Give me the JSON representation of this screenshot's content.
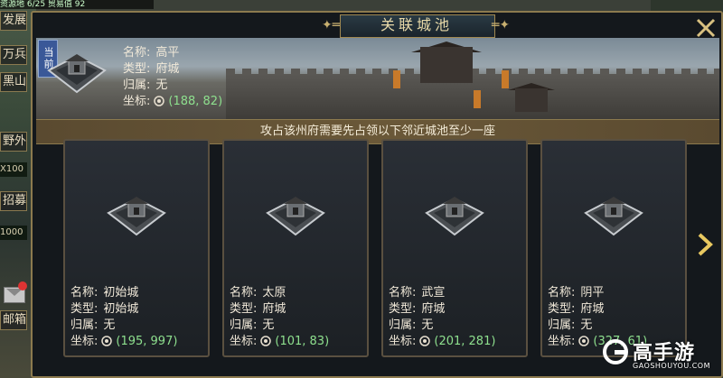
{
  "background": {
    "resource_text": "资源地 6/25  贸易值 92",
    "side_tabs": [
      "发展",
      "万兵",
      "黑山",
      "野外",
      "招募",
      "邮箱"
    ],
    "side_values": [
      "X100",
      "1000"
    ]
  },
  "dialog": {
    "title": "关联城池",
    "current_tag": "当前",
    "labels": {
      "name": "名称:",
      "type": "类型:",
      "owner": "归属:",
      "coord": "坐标:"
    },
    "current_city": {
      "name": "高平",
      "type": "府城",
      "owner": "无",
      "coord": "(188, 82)"
    },
    "notice": "攻占该州府需要先占领以下邻近城池至少一座",
    "cities": [
      {
        "name": "初始城",
        "type": "初始城",
        "owner": "无",
        "coord": "(195, 997)"
      },
      {
        "name": "太原",
        "type": "府城",
        "owner": "无",
        "coord": "(101, 83)"
      },
      {
        "name": "武宣",
        "type": "府城",
        "owner": "无",
        "coord": "(201, 281)"
      },
      {
        "name": "阴平",
        "type": "府城",
        "owner": "无",
        "coord": "(327, 61)"
      }
    ],
    "icons": {
      "close": "close-icon",
      "next": "chevron-right-icon",
      "pin": "location-pin-icon"
    }
  },
  "watermark": {
    "text": "高手游",
    "sub": "GAOSHOUYOU.COM"
  },
  "colors": {
    "coord": "#8ee08e",
    "frame": "#8c7a4e",
    "tag": "#3a5898"
  }
}
